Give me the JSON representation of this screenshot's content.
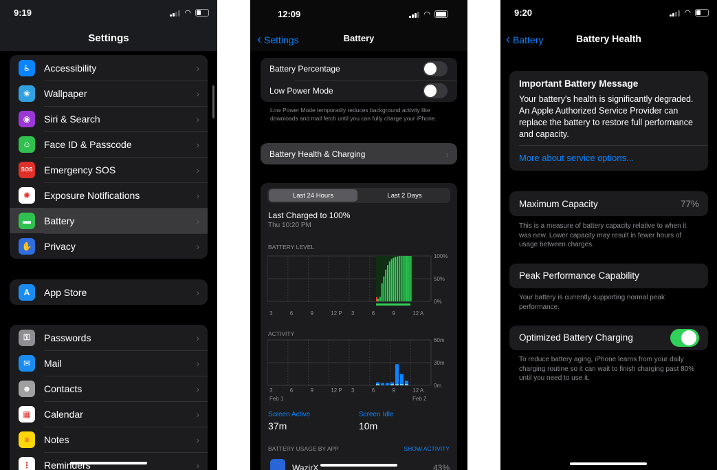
{
  "settings": {
    "time": "9:19",
    "title": "Settings",
    "group1": [
      {
        "label": "Accessibility",
        "icon": "accessibility-icon",
        "glyph": "♿",
        "color": "#0a84ff"
      },
      {
        "label": "Wallpaper",
        "icon": "wallpaper-icon",
        "glyph": "❀",
        "color": "#30a0e0"
      },
      {
        "label": "Siri & Search",
        "icon": "siri-icon",
        "glyph": "◉",
        "color": "#9b37d6"
      },
      {
        "label": "Face ID & Passcode",
        "icon": "face-id-icon",
        "glyph": "☺",
        "color": "#30c050"
      },
      {
        "label": "Emergency SOS",
        "icon": "sos-icon",
        "glyph": "SOS",
        "color": "#e0302a"
      },
      {
        "label": "Exposure Notifications",
        "icon": "exposure-icon",
        "glyph": "✺",
        "color": "#ffffff"
      },
      {
        "label": "Battery",
        "icon": "battery-icon",
        "glyph": "▬",
        "color": "#30c050"
      },
      {
        "label": "Privacy",
        "icon": "privacy-hand-icon",
        "glyph": "✋",
        "color": "#2f6ee0"
      }
    ],
    "group2": [
      {
        "label": "App Store",
        "icon": "app-store-icon",
        "glyph": "A",
        "color": "#1a8cf0"
      }
    ],
    "group3": [
      {
        "label": "Passwords",
        "icon": "key-icon",
        "glyph": "⚿",
        "color": "#8e8e93"
      },
      {
        "label": "Mail",
        "icon": "mail-icon",
        "glyph": "✉",
        "color": "#1a8cf0"
      },
      {
        "label": "Contacts",
        "icon": "contacts-icon",
        "glyph": "☻",
        "color": "#a0a0a0"
      },
      {
        "label": "Calendar",
        "icon": "calendar-icon",
        "glyph": "▦",
        "color": "#ffffff"
      },
      {
        "label": "Notes",
        "icon": "notes-icon",
        "glyph": "≡",
        "color": "#ffd60a"
      },
      {
        "label": "Reminders",
        "icon": "reminders-icon",
        "glyph": "⋮",
        "color": "#ffffff"
      }
    ]
  },
  "battery": {
    "time": "12:09",
    "back_label": "Settings",
    "title": "Battery",
    "battery_percentage_label": "Battery Percentage",
    "battery_percentage_on": false,
    "low_power_label": "Low Power Mode",
    "low_power_on": false,
    "low_power_note": "Low Power Mode temporarily reduces background activity like downloads and mail fetch until you can fully charge your iPhone.",
    "health_row_label": "Battery Health & Charging",
    "segments": [
      "Last 24 Hours",
      "Last 2 Days"
    ],
    "last_charged": "Last Charged to 100%",
    "last_charged_time": "Thu 10:20 PM",
    "level_label": "BATTERY LEVEL",
    "level_ticks": [
      "100%",
      "50%",
      "0%"
    ],
    "x_ticks": [
      "3",
      "6",
      "9",
      "12 P",
      "3",
      "6",
      "9",
      "12 A"
    ],
    "activity_label": "ACTIVITY",
    "activity_ticks": [
      "60m",
      "30m",
      "0m"
    ],
    "date_left": "Feb 1",
    "date_right": "Feb 2",
    "screen_active_label": "Screen Active",
    "screen_active_value": "37m",
    "screen_idle_label": "Screen Idle",
    "screen_idle_value": "10m",
    "usage_label": "BATTERY USAGE BY APP",
    "show_activity": "SHOW ACTIVITY",
    "app_name": "WazirX",
    "app_pct": "43%"
  },
  "health": {
    "time": "9:20",
    "back_label": "Battery",
    "title": "Battery Health",
    "message_title": "Important Battery Message",
    "message_body": "Your battery's health is significantly degraded. An Apple Authorized Service Provider can replace the battery to restore full performance and capacity.",
    "message_link": "More about service options...",
    "max_capacity_label": "Maximum Capacity",
    "max_capacity_value": "77%",
    "max_capacity_note": "This is a measure of battery capacity relative to when it was new. Lower capacity may result in fewer hours of usage between charges.",
    "peak_label": "Peak Performance Capability",
    "peak_note": "Your battery is currently supporting normal peak performance.",
    "optimized_label": "Optimized Battery Charging",
    "optimized_on": true,
    "optimized_note": "To reduce battery aging, iPhone learns from your daily charging routine so it can wait to finish charging past 80% until you need to use it."
  }
}
